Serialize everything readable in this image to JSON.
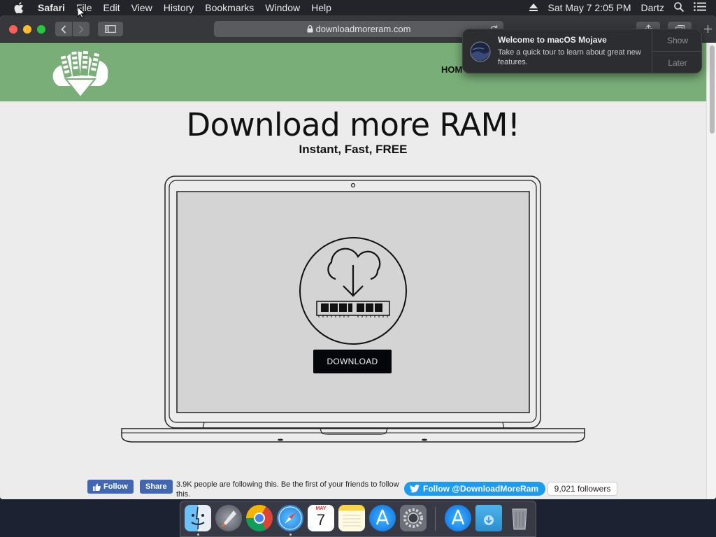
{
  "menubar": {
    "app": "Safari",
    "items": [
      "File",
      "Edit",
      "View",
      "History",
      "Bookmarks",
      "Window",
      "Help"
    ],
    "clock": "Sat May 7  2:05 PM",
    "user": "Dartz"
  },
  "browser": {
    "url": "downloadmoreram.com"
  },
  "site": {
    "nav_home": "HOM",
    "title": "Download more RAM!",
    "subtitle": "Instant, Fast, FREE",
    "download_label": "DOWNLOAD",
    "header_color": "#7aae78"
  },
  "social": {
    "fb_follow": "Follow",
    "fb_share": "Share",
    "fb_text": "3.9K people are following this. Be the first of your friends to follow this.",
    "tw_follow": "Follow @DownloadMoreRam",
    "tw_count": "9,021 followers"
  },
  "notification": {
    "title": "Welcome to macOS Mojave",
    "body": "Take a quick tour to learn about great new features.",
    "show": "Show",
    "later": "Later"
  },
  "dock": {
    "calendar_month": "MAY",
    "calendar_day": "7",
    "apps": [
      "finder-icon",
      "launchpad-icon",
      "chrome-icon",
      "safari-icon",
      "calendar-icon",
      "notes-icon",
      "app-store-icon",
      "system-preferences-icon",
      "app-store-icon",
      "downloads-folder-icon",
      "trash-icon"
    ]
  }
}
